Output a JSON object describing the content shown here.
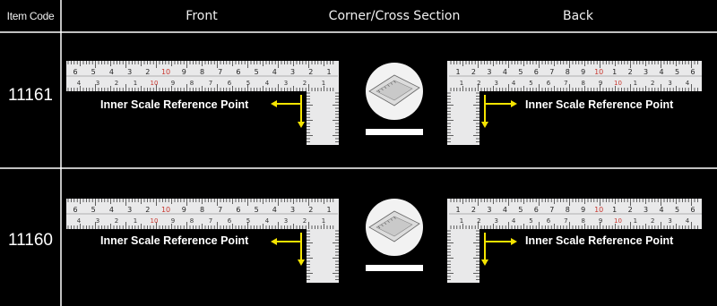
{
  "table": {
    "headers": {
      "item_code": "Item Code",
      "front": "Front",
      "corner": "Corner/Cross Section",
      "back": "Back"
    },
    "rows": [
      {
        "code": "11161",
        "front_label": "Inner Scale Reference Point",
        "back_label": "Inner Scale Reference Point"
      },
      {
        "code": "11160",
        "front_label": "Inner Scale Reference Point",
        "back_label": "Inner Scale Reference Point"
      }
    ]
  },
  "ruler": {
    "front_top_digits": [
      "6",
      "5",
      "4",
      "3",
      "2",
      "10",
      "9",
      "8",
      "7",
      "6",
      "5",
      "4",
      "3",
      "2",
      "1"
    ],
    "front_bottom_digits": [
      "4",
      "3",
      "2",
      "1",
      "10",
      "9",
      "8",
      "7",
      "6",
      "5",
      "4",
      "3",
      "2",
      "1"
    ],
    "back_top_digits": [
      "1",
      "2",
      "3",
      "4",
      "5",
      "6",
      "7",
      "8",
      "9",
      "10",
      "1",
      "2",
      "3",
      "4",
      "5",
      "6"
    ],
    "back_bottom_digits": [
      "1",
      "2",
      "3",
      "4",
      "5",
      "6",
      "7",
      "8",
      "9",
      "10",
      "1",
      "2",
      "3",
      "4"
    ]
  },
  "colors": {
    "background": "#000000",
    "grid_line": "#ffffff",
    "arrow": "#f5e400",
    "ruler_face": "#e9e9ea",
    "ruler_red": "#c8362e"
  }
}
